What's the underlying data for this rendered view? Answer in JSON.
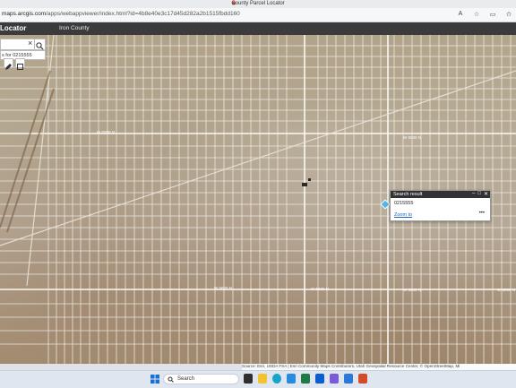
{
  "browser": {
    "window_title": "County Parcel Locator",
    "url_host": "maps.arcgis.com",
    "url_path": "/apps/webappviewer/index.html?id=4b8e40e3c17d45d282a2b1515fbdd160"
  },
  "app": {
    "title": "Locator",
    "subtitle": "Iron County"
  },
  "search": {
    "clear_icon": "×",
    "suggestion": "s for 0215555"
  },
  "map": {
    "road_labels": [
      "W 5000 N",
      "W 5000 N",
      "W 5000 N",
      "W 5000 N",
      "W 5000 N",
      "W 5000 N"
    ]
  },
  "popup": {
    "title": "Search result",
    "value": "0215555",
    "zoom_link": "Zoom to",
    "more": "•••"
  },
  "attribution": {
    "text": "Source: Esri, USDA FSA | Esri Community Maps Contributors, Utah Geospatial Resource Center, © OpenStreetMap, Mi"
  },
  "taskbar": {
    "search_label": "Search"
  },
  "colors": {
    "app_header": "#3b3b3b",
    "popup_marker": "#4fb6e8",
    "link": "#1e66c5"
  }
}
